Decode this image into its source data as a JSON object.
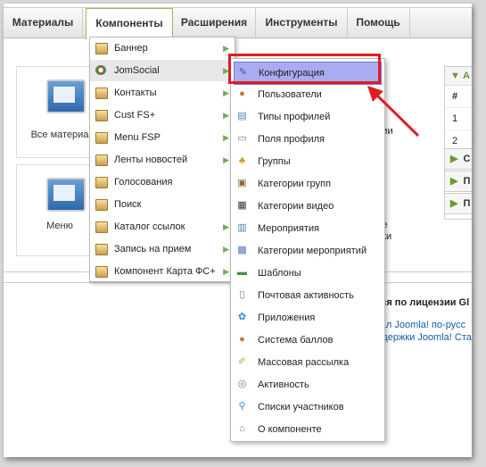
{
  "menubar": {
    "items": [
      "Материалы",
      "Компоненты",
      "Расширения",
      "Инструменты",
      "Помощь"
    ]
  },
  "cpanel": {
    "tile1_label": "Все материа",
    "tile2_label": "Меню",
    "tile3_label": "ции",
    "tile4_label_line1": "ле",
    "tile4_label_line2": "йки"
  },
  "right_panel": {
    "header": "А",
    "col_header": "#",
    "rows": [
      "1",
      "2"
    ],
    "accordions": [
      "С",
      "П",
      "П"
    ]
  },
  "footer": {
    "license_text": "ется по лицензии Gl",
    "link1": "ртал Joomla! по-русс",
    "link2": "оддержки Joomla! Ста"
  },
  "components_menu": {
    "items": [
      {
        "label": "Баннер",
        "submenu": true
      },
      {
        "label": "JomSocial",
        "submenu": true
      },
      {
        "label": "Контакты",
        "submenu": true
      },
      {
        "label": "Cust FS+",
        "submenu": true
      },
      {
        "label": "Menu FSP",
        "submenu": true
      },
      {
        "label": "Ленты новостей",
        "submenu": true
      },
      {
        "label": "Голосования",
        "submenu": false
      },
      {
        "label": "Поиск",
        "submenu": false
      },
      {
        "label": "Каталог ссылок",
        "submenu": true
      },
      {
        "label": "Запись на прием",
        "submenu": true
      },
      {
        "label": "Компонент Карта ФС+",
        "submenu": true
      }
    ]
  },
  "jomsocial_menu": {
    "items": [
      {
        "label": "Конфигурация",
        "icon": "config-icon"
      },
      {
        "label": "Пользователи",
        "icon": "user-icon"
      },
      {
        "label": "Типы профилей",
        "icon": "profile-types-icon"
      },
      {
        "label": "Поля профиля",
        "icon": "profile-fields-icon"
      },
      {
        "label": "Группы",
        "icon": "groups-icon"
      },
      {
        "label": "Категории групп",
        "icon": "group-categories-icon"
      },
      {
        "label": "Категории видео",
        "icon": "video-categories-icon"
      },
      {
        "label": "Мероприятия",
        "icon": "events-icon"
      },
      {
        "label": "Категории мероприятий",
        "icon": "event-categories-icon"
      },
      {
        "label": "Шаблоны",
        "icon": "templates-icon"
      },
      {
        "label": "Почтовая активность",
        "icon": "mail-activity-icon"
      },
      {
        "label": "Приложения",
        "icon": "apps-icon"
      },
      {
        "label": "Система баллов",
        "icon": "points-icon"
      },
      {
        "label": "Массовая рассылка",
        "icon": "mass-mail-icon"
      },
      {
        "label": "Активность",
        "icon": "activity-icon"
      },
      {
        "label": "Списки участников",
        "icon": "member-lists-icon"
      },
      {
        "label": "О компоненте",
        "icon": "about-icon"
      }
    ]
  },
  "colors": {
    "highlight_box": "#e01e22",
    "selected_item": "#a9acf0",
    "submenu_arrow": "#6ab04c"
  }
}
